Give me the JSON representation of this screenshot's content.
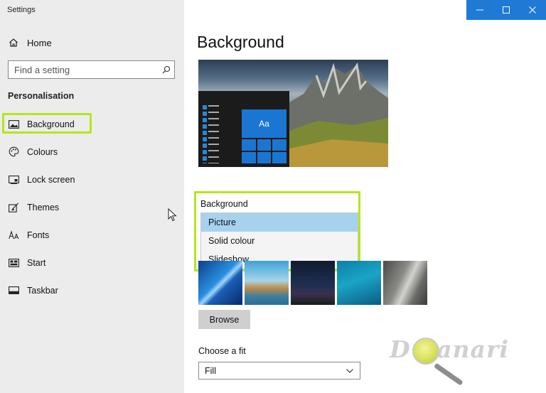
{
  "window": {
    "title": "Settings"
  },
  "sidebar": {
    "home_label": "Home",
    "search_placeholder": "Find a setting",
    "section_heading": "Personalisation",
    "items": [
      {
        "label": "Background",
        "icon": "picture-icon",
        "active": true
      },
      {
        "label": "Colours",
        "icon": "palette-icon"
      },
      {
        "label": "Lock screen",
        "icon": "lock-screen-icon"
      },
      {
        "label": "Themes",
        "icon": "themes-icon"
      },
      {
        "label": "Fonts",
        "icon": "fonts-icon"
      },
      {
        "label": "Start",
        "icon": "start-icon"
      },
      {
        "label": "Taskbar",
        "icon": "taskbar-icon"
      }
    ]
  },
  "main": {
    "title": "Background",
    "preview": {
      "tile_label": "Aa"
    },
    "background_dropdown": {
      "label": "Background",
      "options": [
        "Picture",
        "Solid colour",
        "Slideshow"
      ],
      "selected": "Picture"
    },
    "browse_label": "Browse",
    "fit": {
      "label": "Choose a fit",
      "value": "Fill"
    }
  },
  "watermark": {
    "text": "D panari"
  },
  "colors": {
    "accent": "#1f7ad6",
    "highlight": "#b5e61d",
    "selection": "#a6d2ee",
    "sidebar_bg": "#ececec"
  }
}
